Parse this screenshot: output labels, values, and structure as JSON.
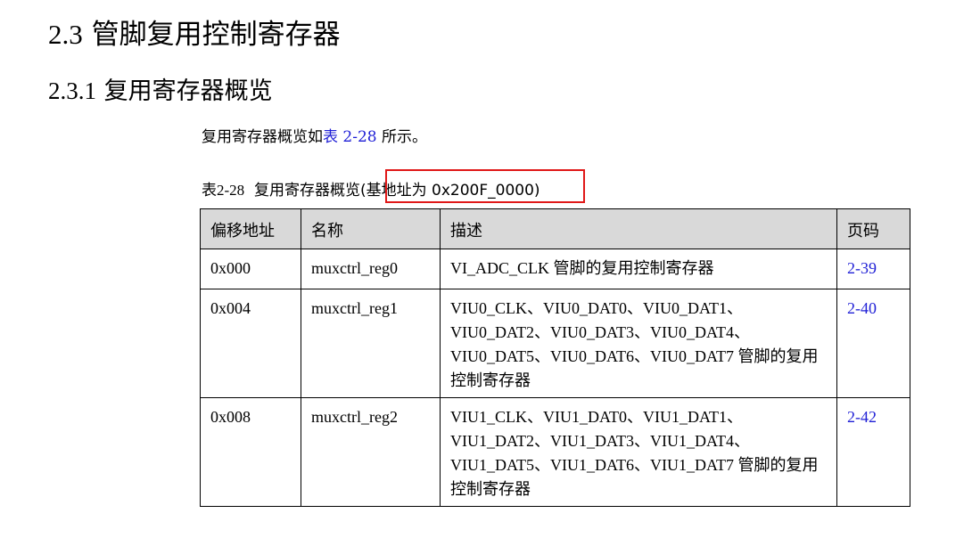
{
  "heading_1": {
    "number": "2.3",
    "title": "管脚复用控制寄存器"
  },
  "heading_2": {
    "number": "2.3.1",
    "title": "复用寄存器概览"
  },
  "intro": {
    "before": "复用寄存器概览如",
    "link": "表 2-28",
    "after": " 所示。"
  },
  "caption": {
    "number": "表2-28",
    "label": "复用寄存器概览",
    "base_address_note": "(基地址为 0x200F_0000)"
  },
  "colors": {
    "highlight_border": "#e01818",
    "link": "#1f1fd6",
    "header_bg": "#d9d9d9"
  },
  "table": {
    "headers": [
      "偏移地址",
      "名称",
      "描述",
      "页码"
    ],
    "rows": [
      {
        "offset": "0x000",
        "name": "muxctrl_reg0",
        "description": "VI_ADC_CLK 管脚的复用控制寄存器",
        "page": "2-39"
      },
      {
        "offset": "0x004",
        "name": "muxctrl_reg1",
        "description": "VIU0_CLK、VIU0_DAT0、VIU0_DAT1、VIU0_DAT2、VIU0_DAT3、VIU0_DAT4、VIU0_DAT5、VIU0_DAT6、VIU0_DAT7 管脚的复用控制寄存器",
        "page": "2-40"
      },
      {
        "offset": "0x008",
        "name": "muxctrl_reg2",
        "description": "VIU1_CLK、VIU1_DAT0、VIU1_DAT1、VIU1_DAT2、VIU1_DAT3、VIU1_DAT4、VIU1_DAT5、VIU1_DAT6、VIU1_DAT7 管脚的复用控制寄存器",
        "page": "2-42"
      }
    ]
  }
}
